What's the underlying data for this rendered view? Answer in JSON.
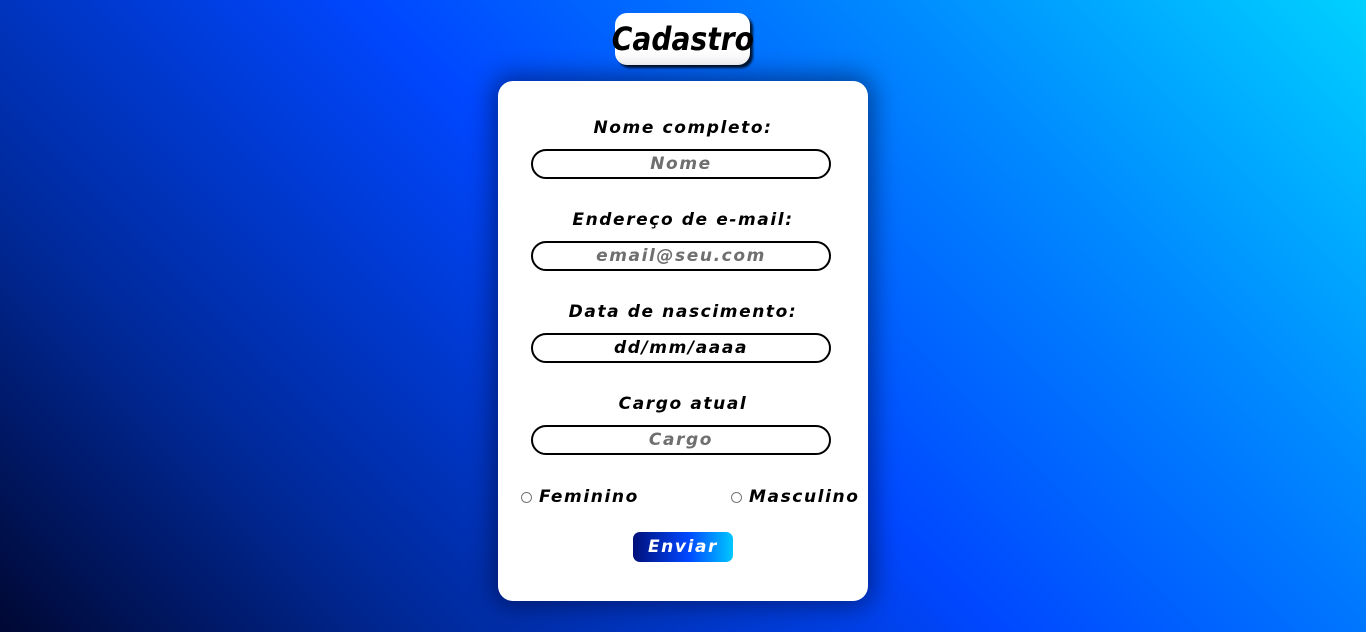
{
  "page": {
    "title": "Cadastro"
  },
  "form": {
    "fields": [
      {
        "label": "Nome completo:",
        "placeholder": "Nome",
        "value": ""
      },
      {
        "label": "Endereço de e-mail:",
        "placeholder": "email@seu.com",
        "value": ""
      },
      {
        "label": "Data de nascimento:",
        "placeholder": "",
        "value": "dd/mm/aaaa"
      },
      {
        "label": "Cargo atual",
        "placeholder": "Cargo",
        "value": ""
      }
    ],
    "gender_options": [
      {
        "label": "Feminino",
        "checked": false
      },
      {
        "label": "Masculino",
        "checked": false
      }
    ],
    "submit_label": "Enviar"
  },
  "colors": {
    "background_start": "#000833",
    "background_mid": "#0047ff",
    "background_end": "#00d1ff",
    "card": "#ffffff",
    "text": "#000000",
    "placeholder": "#6f6f6f",
    "button_text": "#ffffff"
  }
}
